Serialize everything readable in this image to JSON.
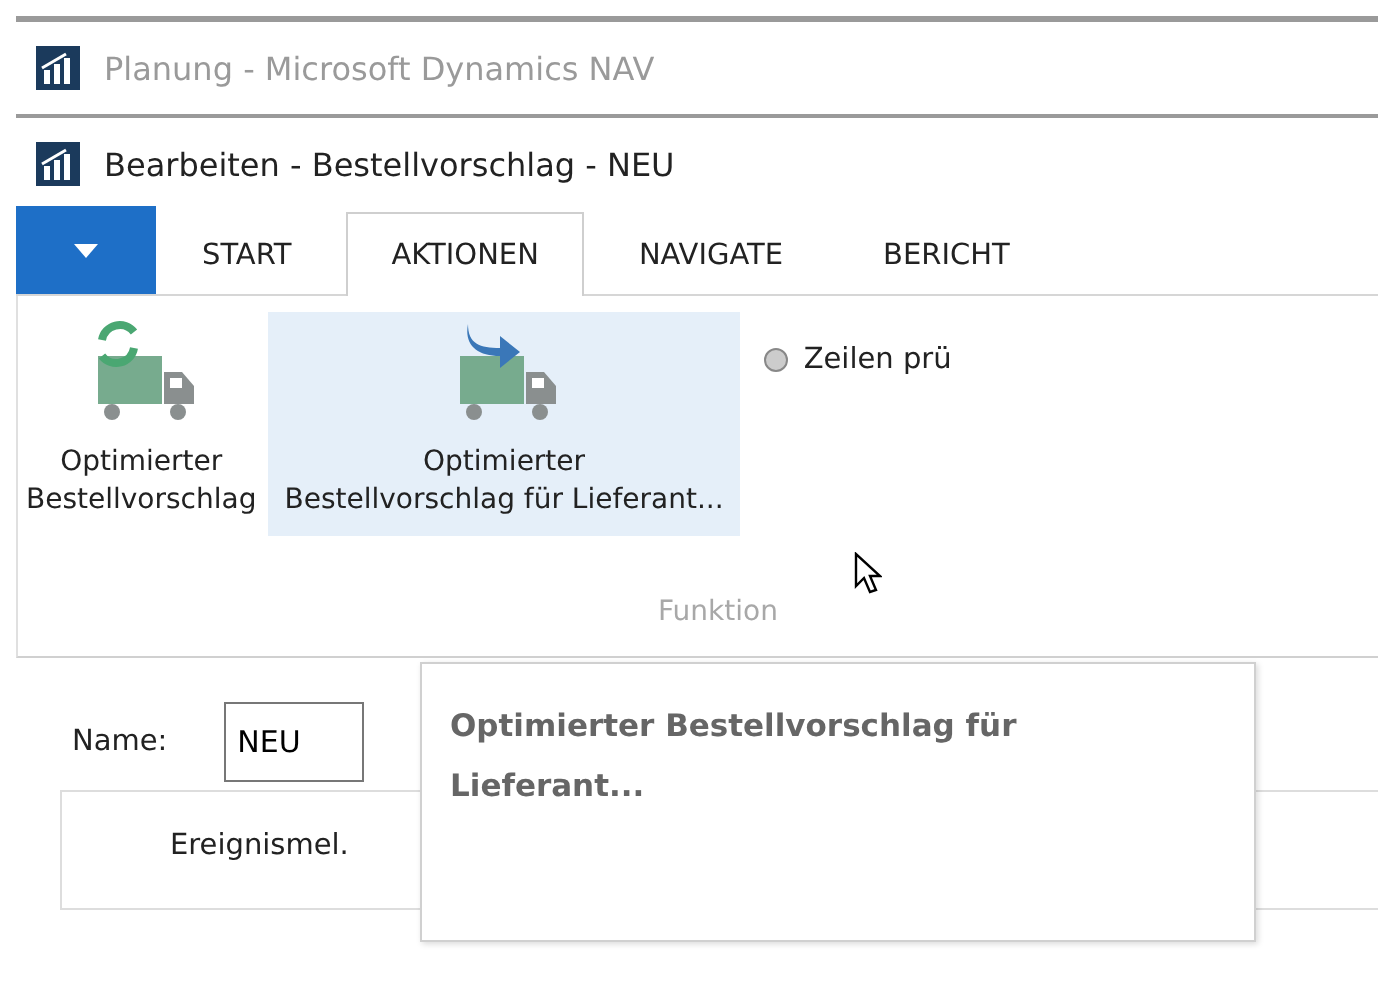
{
  "windows": [
    {
      "title": "Planung - Microsoft Dynamics NAV",
      "active": false
    },
    {
      "title": "Bearbeiten - Bestellvorschlag - NEU",
      "active": true
    }
  ],
  "tabs": [
    {
      "label": "START",
      "selected": false
    },
    {
      "label": "AKTIONEN",
      "selected": true
    },
    {
      "label": "NAVIGATE",
      "selected": false
    },
    {
      "label": "BERICHT",
      "selected": false
    }
  ],
  "ribbon": {
    "actions": [
      {
        "label_lines": [
          "Optimierter",
          "Bestellvorschlag"
        ],
        "kind": "refresh",
        "hovered": false
      },
      {
        "label_lines": [
          "Optimierter",
          "Bestellvorschlag für Lieferant..."
        ],
        "kind": "forward",
        "hovered": true
      }
    ],
    "group_label": "Funktion",
    "option": {
      "label": "Zeilen prü",
      "checked": false
    }
  },
  "form": {
    "name_label": "Name:",
    "name_value": "NEU",
    "column_header": "Ereignismel."
  },
  "tooltip": {
    "title": "Optimierter Bestellvorschlag für Lieferant..."
  }
}
